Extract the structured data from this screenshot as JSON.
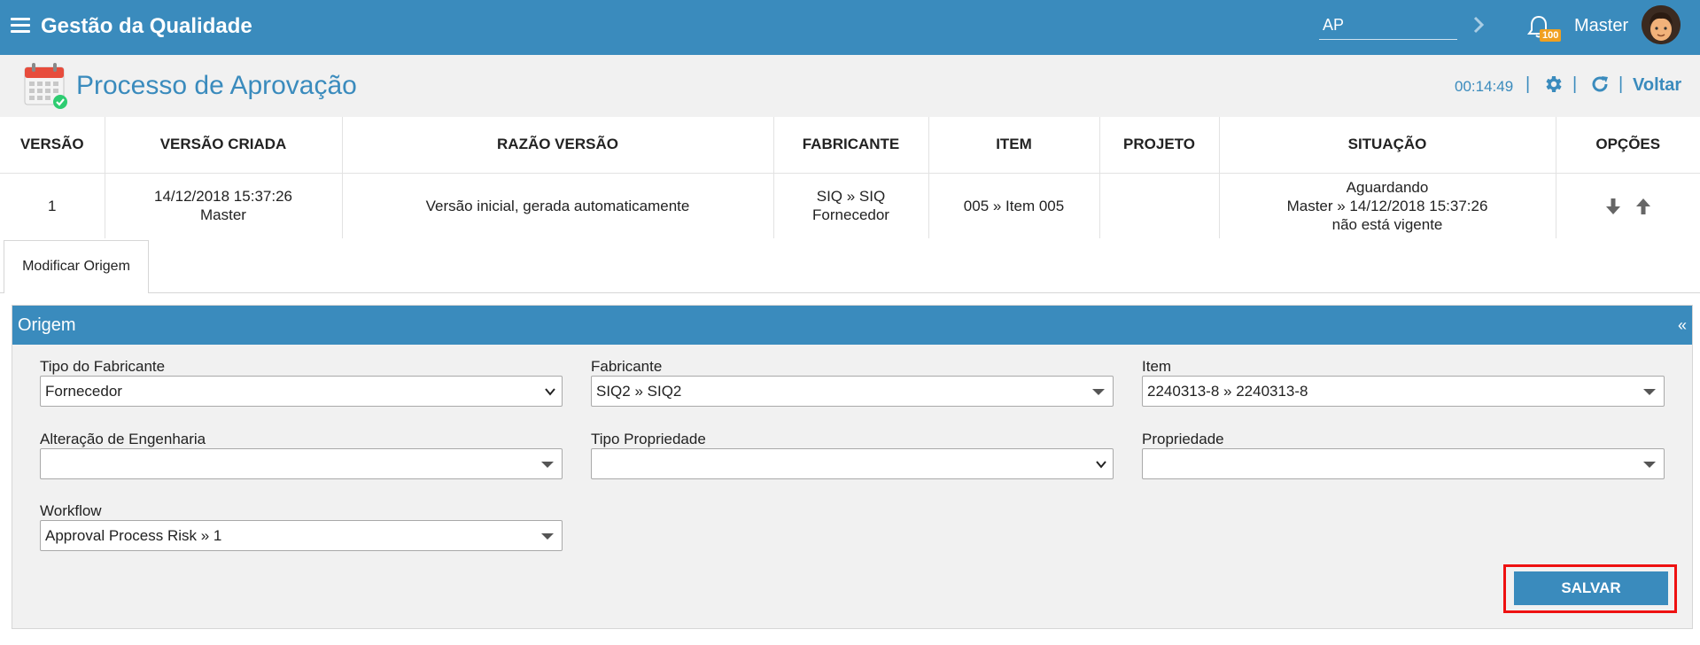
{
  "topbar": {
    "app_title": "Gestão da Qualidade",
    "search_value": "AP",
    "notification_count": "100",
    "user_name": "Master"
  },
  "page_header": {
    "title": "Processo de Aprovação",
    "timer": "00:14:49",
    "back_label": "Voltar"
  },
  "table": {
    "headers": [
      "VERSÃO",
      "VERSÃO CRIADA",
      "RAZÃO VERSÃO",
      "FABRICANTE",
      "ITEM",
      "PROJETO",
      "SITUAÇÃO",
      "OPÇÕES"
    ],
    "rows": [
      {
        "versao": "1",
        "criada_date": "14/12/2018 15:37:26",
        "criada_user": "Master",
        "razao": "Versão inicial, gerada automaticamente",
        "fabricante_1": "SIQ » SIQ",
        "fabricante_2": "Fornecedor",
        "item": "005 » Item 005",
        "projeto": "",
        "situacao_1": "Aguardando",
        "situacao_2": "Master » 14/12/2018 15:37:26",
        "situacao_3": "não está vigente"
      }
    ]
  },
  "tabs": [
    {
      "label": "Modificar Origem"
    }
  ],
  "panel": {
    "title": "Origem",
    "collapse_symbol": "«",
    "fields": {
      "tipo_fabricante": {
        "label": "Tipo do Fabricante",
        "value": "Fornecedor"
      },
      "fabricante": {
        "label": "Fabricante",
        "value": "SIQ2 » SIQ2"
      },
      "item": {
        "label": "Item",
        "value": "2240313-8 » 2240313-8"
      },
      "alteracao": {
        "label": "Alteração de Engenharia",
        "value": ""
      },
      "tipo_propriedade": {
        "label": "Tipo Propriedade",
        "value": ""
      },
      "propriedade": {
        "label": "Propriedade",
        "value": ""
      },
      "workflow": {
        "label": "Workflow",
        "value": "Approval Process Risk » 1"
      }
    },
    "save_label": "SALVAR"
  },
  "colors": {
    "primary": "#3a8bbd",
    "header_bg": "#f1f1f1",
    "badge": "#f0a020",
    "highlight": "#ee1111",
    "calendar_red": "#e74c3c",
    "check_green": "#2ecc71"
  },
  "icons": [
    "hamburger-icon",
    "chevron-right-icon",
    "bell-icon",
    "avatar",
    "calendar-check-icon",
    "gear-icon",
    "refresh-icon",
    "arrow-down-icon",
    "arrow-up-icon",
    "chevron-down-icon",
    "caret-down-icon"
  ]
}
